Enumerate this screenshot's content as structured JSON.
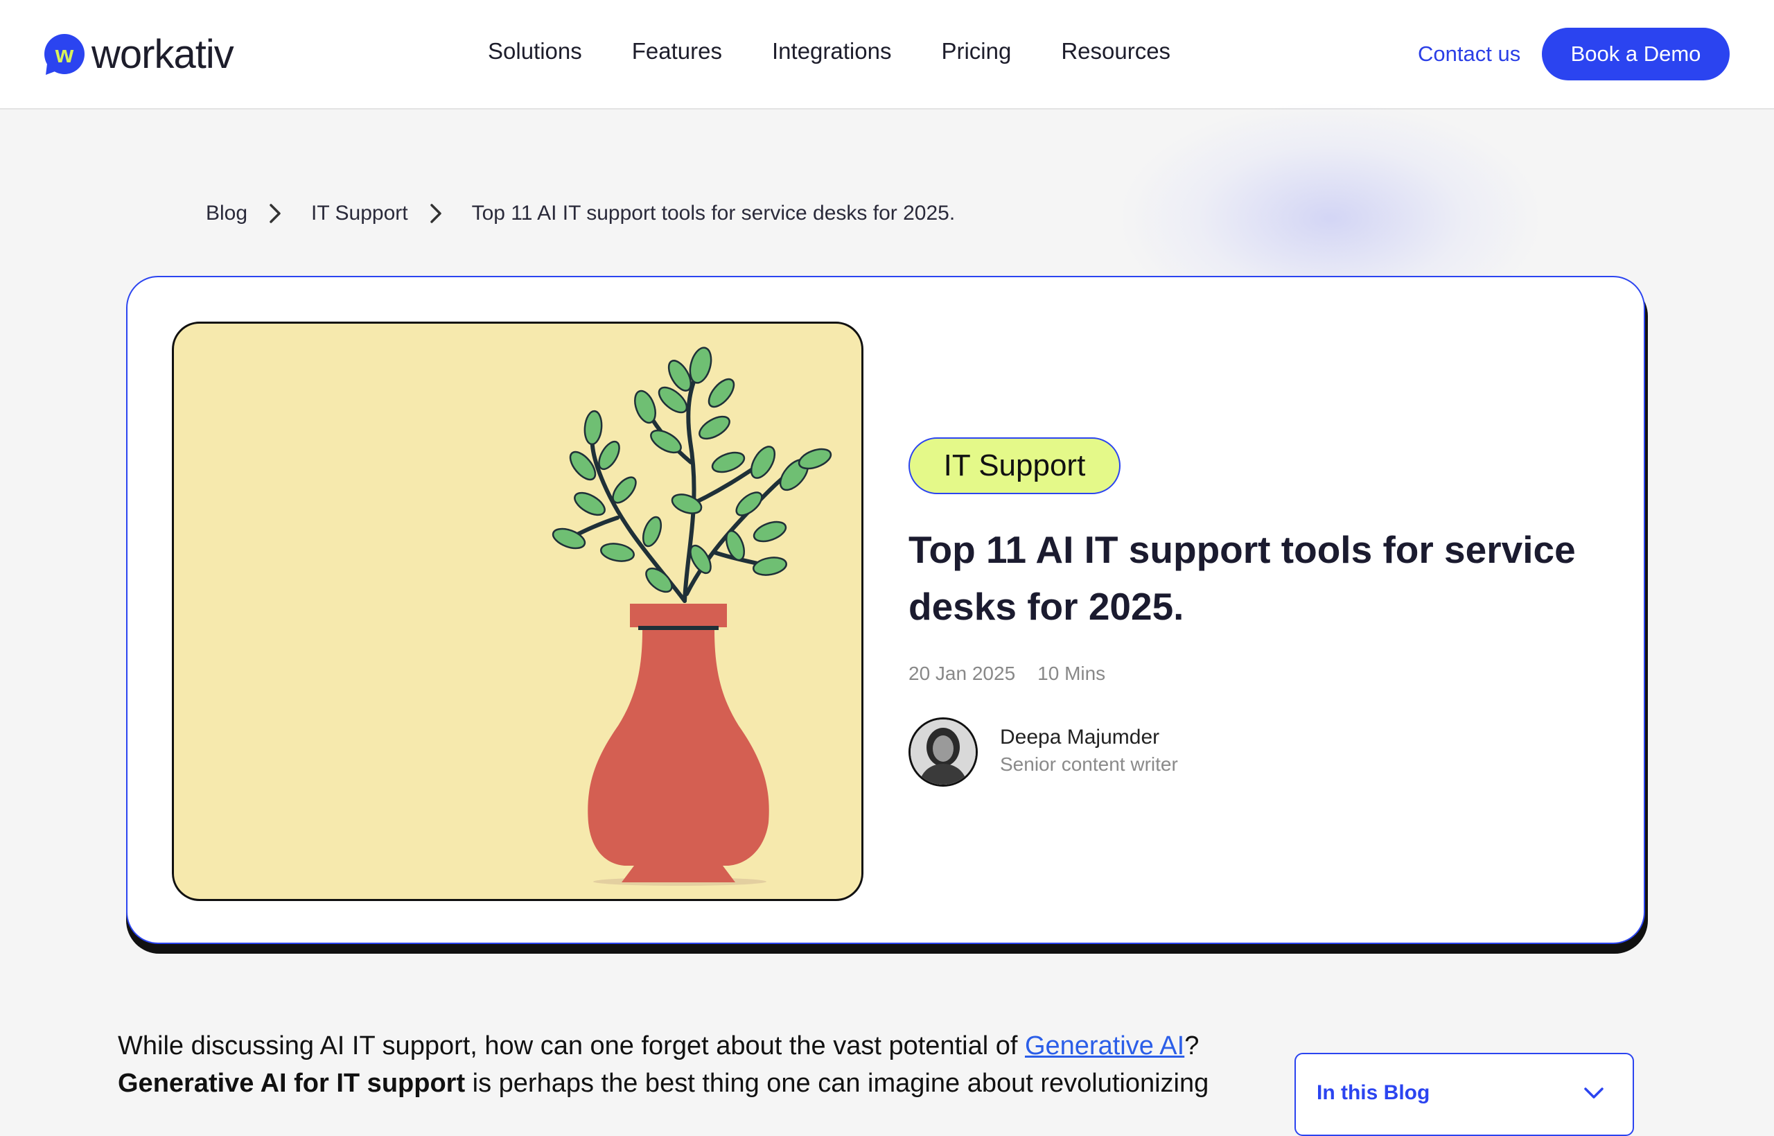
{
  "brand": {
    "name": "workativ",
    "mark_letter": "w"
  },
  "nav": {
    "items": [
      "Solutions",
      "Features",
      "Integrations",
      "Pricing",
      "Resources"
    ],
    "contact_label": "Contact us",
    "demo_label": "Book a Demo"
  },
  "breadcrumb": {
    "items": [
      "Blog",
      "IT Support"
    ],
    "current": "Top 11 AI IT support tools for service desks for 2025."
  },
  "hero": {
    "tag": "IT Support",
    "title": "Top 11 AI IT support tools for service desks for 2025.",
    "date": "20 Jan 2025",
    "read_time": "10 Mins",
    "author_name": "Deepa Majumder",
    "author_role": "Senior content writer"
  },
  "article": {
    "intro_part1": "While discussing AI IT support, how can one forget about the vast potential of ",
    "intro_link": "Generative AI",
    "intro_part2": "?",
    "intro_bold": "Generative AI for IT support",
    "intro_part3": " is perhaps the best thing one can imagine about revolutionizing"
  },
  "toc": {
    "label": "In this Blog"
  },
  "colors": {
    "accent": "#2b44f0",
    "tag_bg": "#e4f989",
    "hero_bg": "#f6e9ad",
    "vase": "#d45f52",
    "leaf": "#6fbf73"
  }
}
